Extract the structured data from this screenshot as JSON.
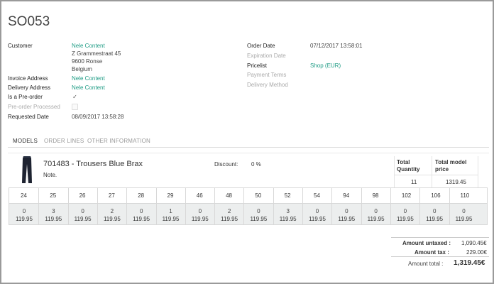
{
  "order": {
    "title": "SO053",
    "customer_label": "Customer",
    "customer_name": "Nele Content",
    "address_line1": "Z Grammestraat 45",
    "address_line2": "9600 Ronse",
    "address_line3": "Belgium",
    "invoice_address_label": "Invoice Address",
    "invoice_address_value": "Nele Content",
    "delivery_address_label": "Delivery Address",
    "delivery_address_value": "Nele Content",
    "preorder_label": "Is a Pre-order",
    "preorder_checked": true,
    "preorder_processed_label": "Pre-order Processed",
    "preorder_processed_checked": false,
    "requested_date_label": "Requested Date",
    "requested_date_value": "08/09/2017 13:58:28",
    "order_date_label": "Order Date",
    "order_date_value": "07/12/2017 13:58:01",
    "expiration_date_label": "Expiration Date",
    "pricelist_label": "Pricelist",
    "pricelist_value": "Shop (EUR)",
    "payment_terms_label": "Payment Terms",
    "delivery_method_label": "Delivery Method"
  },
  "tabs": [
    {
      "label": "MODELS",
      "active": true
    },
    {
      "label": "ORDER LINES",
      "active": false
    },
    {
      "label": "OTHER INFORMATION",
      "active": false
    }
  ],
  "model": {
    "name": "701483 - Trousers Blue Brax",
    "note_label": "Note.",
    "discount_label": "Discount:",
    "discount_value": "0 %",
    "total_quantity_label_1": "Total",
    "total_quantity_label_2": "Quantity",
    "total_model_price_label_1": "Total model",
    "total_model_price_label_2": "price",
    "total_quantity_value": "11",
    "total_model_price_value": "1319.45",
    "sizes": [
      {
        "size": "24",
        "qty": "0",
        "price": "119.95"
      },
      {
        "size": "25",
        "qty": "3",
        "price": "119.95"
      },
      {
        "size": "26",
        "qty": "0",
        "price": "119.95"
      },
      {
        "size": "27",
        "qty": "2",
        "price": "119.95"
      },
      {
        "size": "28",
        "qty": "0",
        "price": "119.95"
      },
      {
        "size": "29",
        "qty": "1",
        "price": "119.95"
      },
      {
        "size": "46",
        "qty": "0",
        "price": "119.95"
      },
      {
        "size": "48",
        "qty": "2",
        "price": "119.95"
      },
      {
        "size": "50",
        "qty": "0",
        "price": "119.95"
      },
      {
        "size": "52",
        "qty": "3",
        "price": "119.95"
      },
      {
        "size": "54",
        "qty": "0",
        "price": "119.95"
      },
      {
        "size": "94",
        "qty": "0",
        "price": "119.95"
      },
      {
        "size": "98",
        "qty": "0",
        "price": "119.95"
      },
      {
        "size": "102",
        "qty": "0",
        "price": "119.95"
      },
      {
        "size": "106",
        "qty": "0",
        "price": "119.95"
      },
      {
        "size": "110",
        "qty": "0",
        "price": "119.95"
      }
    ]
  },
  "amounts": {
    "untaxed_label": "Amount untaxed :",
    "untaxed_value": "1,090.45€",
    "tax_label": "Amount tax :",
    "tax_value": "229.00€",
    "total_label": "Amount total :",
    "total_value": "1,319.45€"
  },
  "colors": {
    "link": "#1f9c85",
    "grid_body": "#eceeee"
  }
}
